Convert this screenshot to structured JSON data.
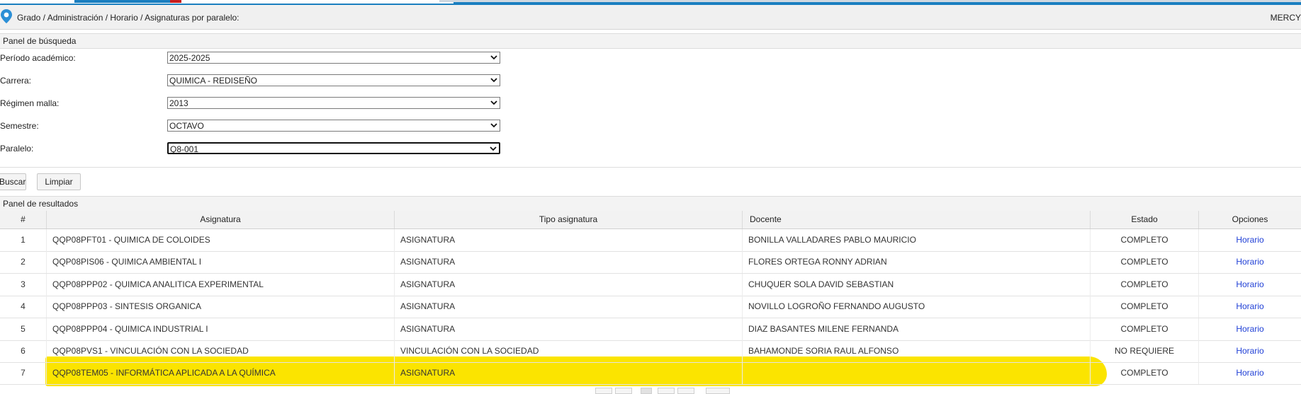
{
  "breadcrumb": {
    "path": "Grado / Administración / Horario / Asignaturas por paralelo:",
    "user": "MERCY"
  },
  "search_panel": {
    "title": "Panel de búsqueda",
    "fields": [
      {
        "label": "Período académico:",
        "value": "2025-2025"
      },
      {
        "label": "Carrera:",
        "value": "QUIMICA - REDISEÑO"
      },
      {
        "label": "Régimen malla:",
        "value": "2013"
      },
      {
        "label": "Semestre:",
        "value": "OCTAVO"
      },
      {
        "label": "Paralelo:",
        "value": "Q8-001"
      }
    ],
    "buttons": {
      "search": "Buscar",
      "clear": "Limpiar"
    }
  },
  "results_panel": {
    "title": "Panel de resultados",
    "headers": [
      "#",
      "Asignatura",
      "Tipo asignatura",
      "Docente",
      "Estado",
      "Opciones"
    ],
    "rows": [
      {
        "n": "1",
        "asignatura": "QQP08PFT01 - QUIMICA DE COLOIDES",
        "tipo": "ASIGNATURA",
        "docente": "BONILLA VALLADARES PABLO MAURICIO",
        "estado": "COMPLETO",
        "opcion": "Horario"
      },
      {
        "n": "2",
        "asignatura": "QQP08PIS06 - QUIMICA AMBIENTAL I",
        "tipo": "ASIGNATURA",
        "docente": "FLORES ORTEGA RONNY ADRIAN",
        "estado": "COMPLETO",
        "opcion": "Horario"
      },
      {
        "n": "3",
        "asignatura": "QQP08PPP02 - QUIMICA ANALITICA EXPERIMENTAL",
        "tipo": "ASIGNATURA",
        "docente": "CHUQUER SOLA DAVID SEBASTIAN",
        "estado": "COMPLETO",
        "opcion": "Horario"
      },
      {
        "n": "4",
        "asignatura": "QQP08PPP03 - SINTESIS ORGANICA",
        "tipo": "ASIGNATURA",
        "docente": "NOVILLO LOGROÑO FERNANDO AUGUSTO",
        "estado": "COMPLETO",
        "opcion": "Horario"
      },
      {
        "n": "5",
        "asignatura": "QQP08PPP04 - QUIMICA INDUSTRIAL I",
        "tipo": "ASIGNATURA",
        "docente": "DIAZ BASANTES MILENE FERNANDA",
        "estado": "COMPLETO",
        "opcion": "Horario"
      },
      {
        "n": "6",
        "asignatura": "QQP08PVS1 - VINCULACIÓN CON LA SOCIEDAD",
        "tipo": "VINCULACIÓN CON LA SOCIEDAD",
        "docente": "BAHAMONDE SORIA RAUL ALFONSO",
        "estado": "NO REQUIERE",
        "opcion": "Horario"
      },
      {
        "n": "7",
        "asignatura": "QQP08TEM05 - INFORMÁTICA APLICADA A LA QUÍMICA",
        "tipo": "ASIGNATURA",
        "docente": "",
        "estado": "COMPLETO",
        "opcion": "Horario"
      }
    ]
  },
  "colors": {
    "accent": "#1a7fc0",
    "link": "#1f3fd6",
    "highlight": "#fbe400"
  }
}
